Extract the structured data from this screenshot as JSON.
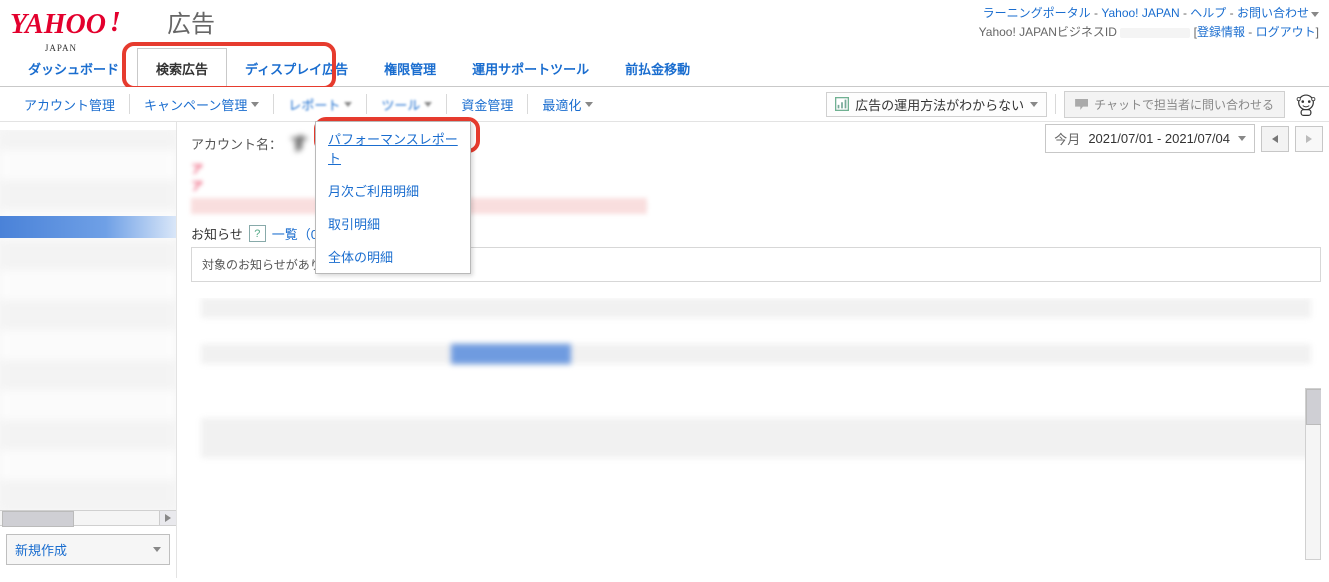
{
  "header": {
    "logo_main": "YAHOO",
    "logo_ex": "!",
    "logo_sub": "JAPAN",
    "logo_suffix": "広告",
    "links": {
      "learning": "ラーニングポータル",
      "yahoo_jp": "Yahoo! JAPAN",
      "help": "ヘルプ",
      "contact": "お問い合わせ"
    },
    "biz_id_label": "Yahoo! JAPANビジネスID",
    "reg_info": "登録情報",
    "logout": "ログアウト"
  },
  "tabs": {
    "dashboard": "ダッシュボード",
    "search_ads": "検索広告",
    "display_ads": "ディスプレイ広告",
    "perm": "権限管理",
    "ops_tool": "運用サポートツール",
    "prepay": "前払金移動"
  },
  "subnav": {
    "account_mgmt": "アカウント管理",
    "campaign_mgmt": "キャンペーン管理",
    "report": "レポート",
    "tool": "ツール",
    "fund_mgmt": "資金管理",
    "optimize": "最適化",
    "help_text": "広告の運用方法がわからない",
    "chat_btn": "チャットで担当者に問い合わせる"
  },
  "dropdown": {
    "perf_report": "パフォーマンスレポート",
    "monthly": "月次ご利用明細",
    "txn": "取引明細",
    "all": "全体の明細"
  },
  "main": {
    "account_label": "アカウント名：",
    "account_name_masked": "す",
    "alert_prefix": "ア",
    "notice_label": "お知らせ",
    "notice_list": "一覧（0）",
    "notice_empty": "対象のお知らせがありません。"
  },
  "date": {
    "period_label": "今月",
    "range": "2021/07/01 - 2021/07/04"
  },
  "side": {
    "new_btn": "新規作成"
  }
}
